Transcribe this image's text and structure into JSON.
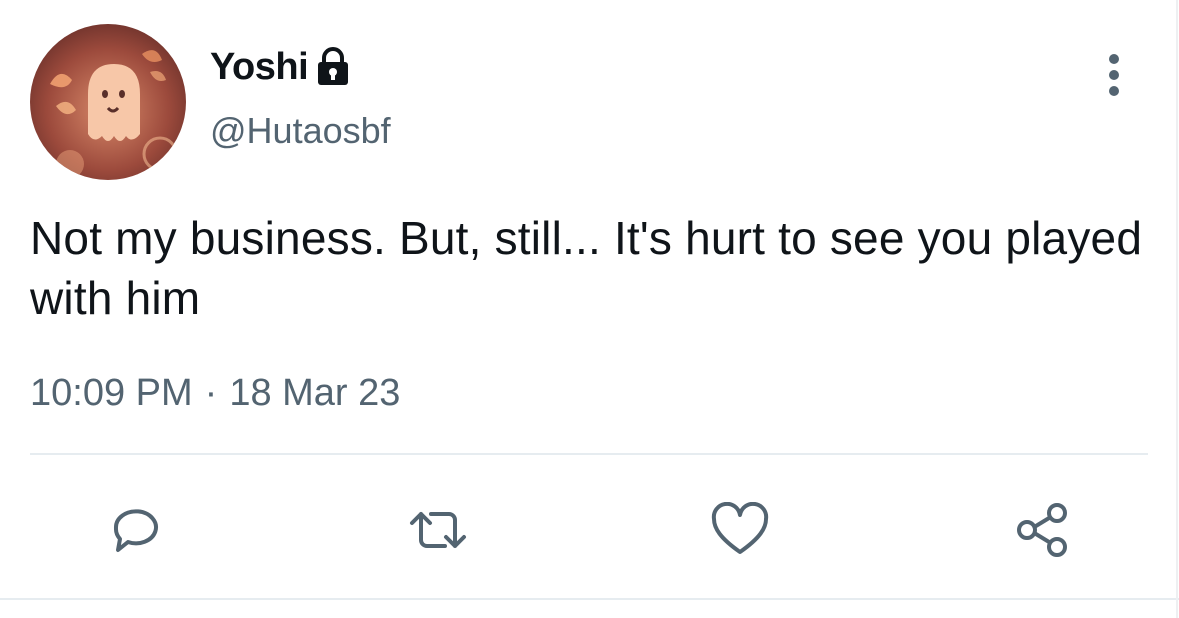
{
  "user": {
    "display_name": "Yoshi",
    "handle": "@Hutaosbf",
    "avatar_icon": "ghost-avatar-icon",
    "locked_icon": "lock-icon"
  },
  "tweet": {
    "text": "Not my business. But, still... It's hurt to see you played with him",
    "time": "10:09 PM",
    "separator": "·",
    "date": "18 Mar 23"
  },
  "actions": {
    "reply_icon": "reply-icon",
    "retweet_icon": "retweet-icon",
    "like_icon": "heart-icon",
    "share_icon": "share-icon",
    "more_icon": "more-vertical-icon"
  },
  "colors": {
    "text_primary": "#0f1419",
    "text_secondary": "#536471",
    "divider": "#e6ecf0",
    "icon": "#536471"
  }
}
